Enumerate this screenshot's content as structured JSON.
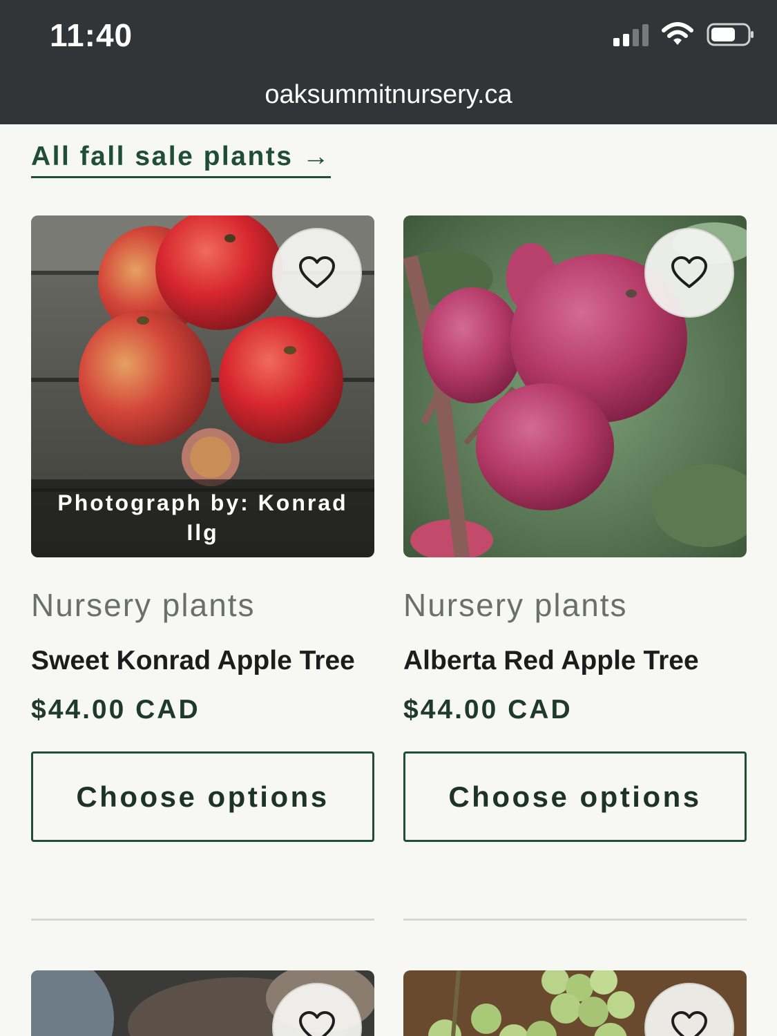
{
  "status_bar": {
    "time": "11:40"
  },
  "browser": {
    "url": "oaksummitnursery.ca"
  },
  "collection_link": {
    "label": "All fall sale plants →"
  },
  "products": [
    {
      "vendor": "Nursery plants",
      "title": "Sweet Konrad Apple Tree",
      "price": "$44.00 CAD",
      "button_label": "Choose options",
      "caption_line1": "Photograph by: Konrad",
      "caption_line2": "Ilg",
      "image_subject": "red apples on wooden table with coin"
    },
    {
      "vendor": "Nursery plants",
      "title": "Alberta Red Apple Tree",
      "price": "$44.00 CAD",
      "button_label": "Choose options",
      "image_subject": "pink-red apples on branch"
    }
  ],
  "colors": {
    "status_bar_bg": "#323537",
    "page_bg": "#f7f7f3",
    "brand_green": "#1f4d35"
  },
  "icons": {
    "wishlist": "heart-outline-icon",
    "signal": "cellular-signal-icon",
    "wifi": "wifi-icon",
    "battery": "battery-icon"
  }
}
